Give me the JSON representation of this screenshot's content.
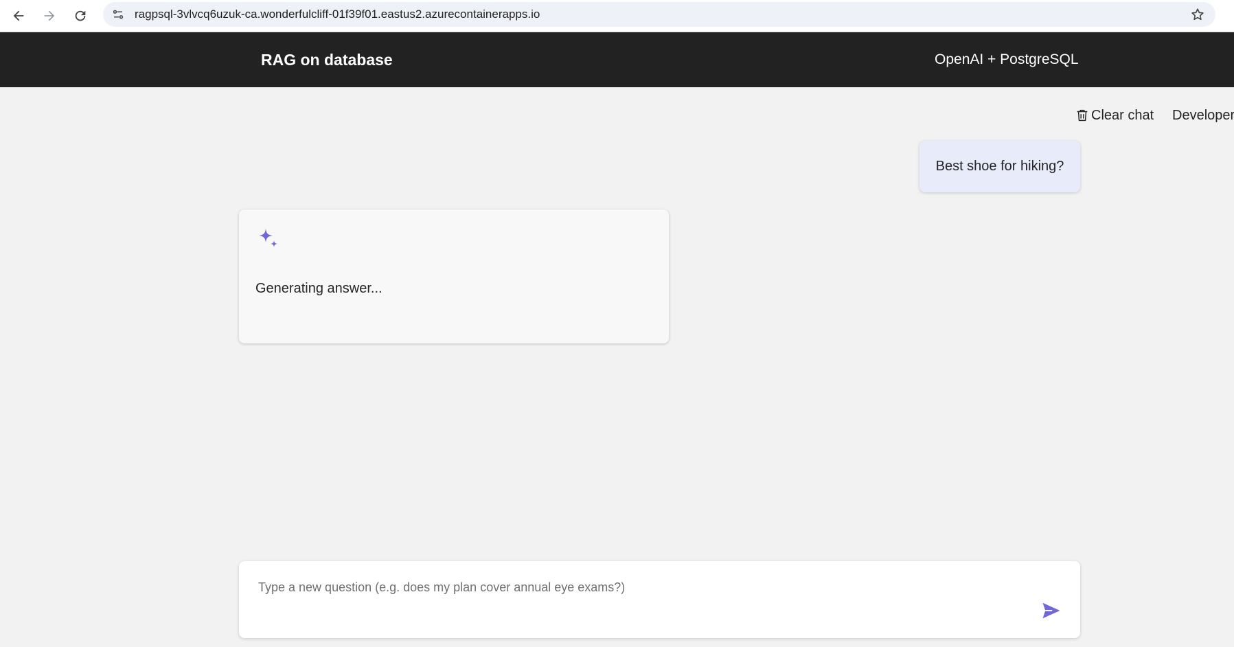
{
  "browser": {
    "url": "ragpsql-3vlvcq6uzuk-ca.wonderfulcliff-01f39f01.eastus2.azurecontainerapps.io",
    "icons": [
      "back-arrow-icon",
      "forward-arrow-icon",
      "reload-icon",
      "site-info-icon",
      "bookmark-star-icon"
    ]
  },
  "header": {
    "title": "RAG on database",
    "subtitle": "OpenAI + PostgreSQL",
    "background": "#222222"
  },
  "command_bar": {
    "clear_label": "Clear chat",
    "developer_label": "Developer settings",
    "icons": [
      "trash-icon",
      "gear-icon"
    ]
  },
  "chat": {
    "user_message": "Best shoe for hiking?",
    "assistant_status": "Generating answer...",
    "assistant_icon": "sparkle-icon",
    "user_bubble_color": "#e8ebfa"
  },
  "input": {
    "placeholder": "Type a new question (e.g. does my plan cover annual eye exams?)",
    "value": "",
    "send_icon": "send-icon"
  },
  "colors": {
    "accent": "#7067d8",
    "page_background": "#f2f2f2"
  }
}
